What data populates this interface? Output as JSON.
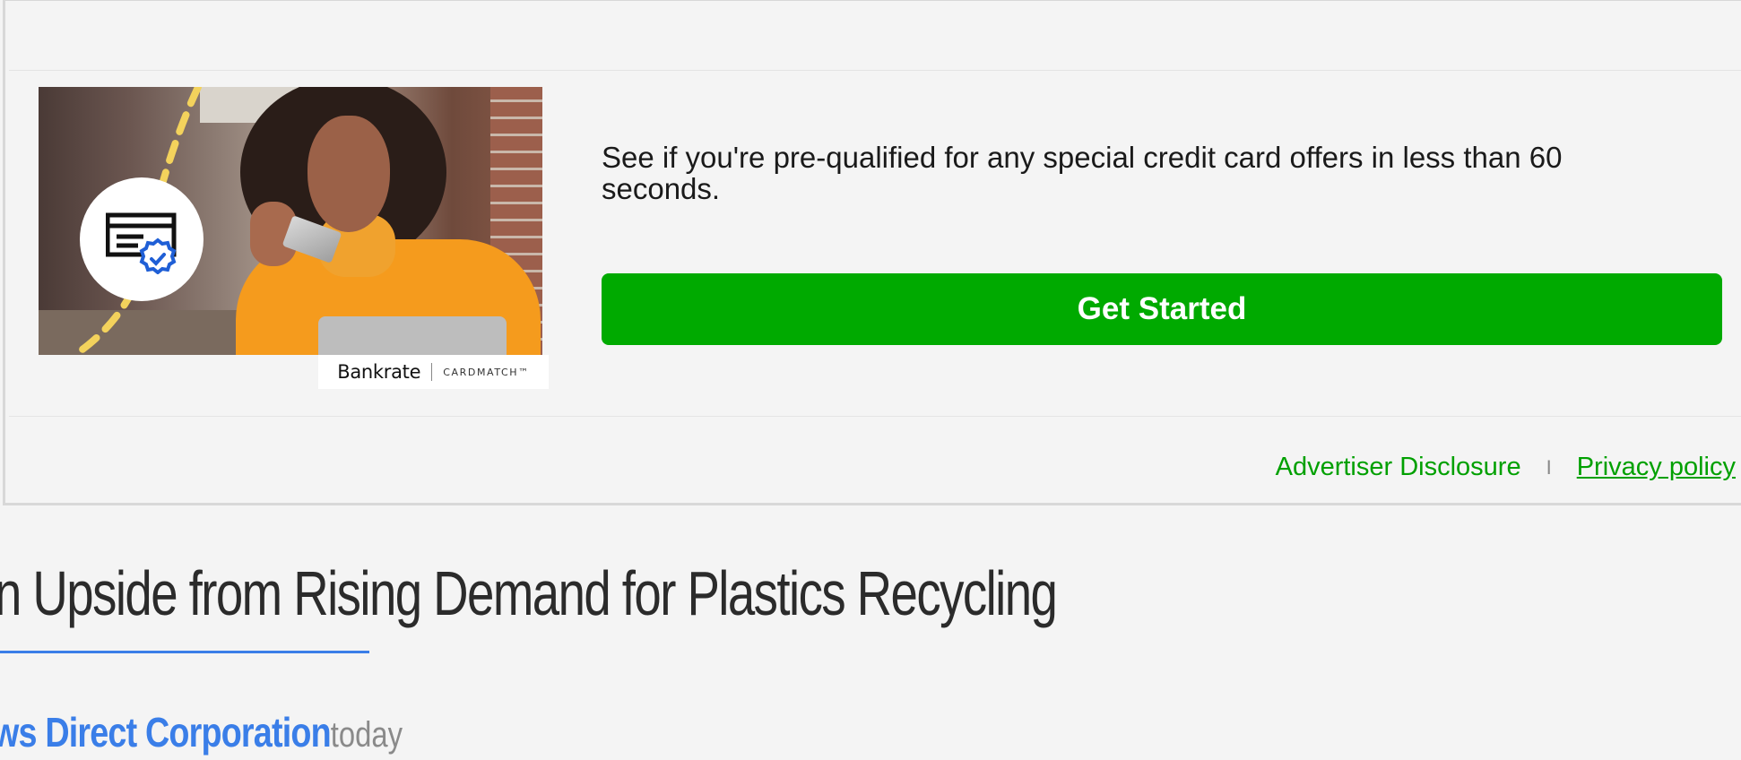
{
  "ad": {
    "text": "See if you're pre-qualified for any special credit card offers in less than 60 seconds.",
    "cta_label": "Get Started",
    "logo": {
      "brand": "Bankrate",
      "product": "CARDMATCH™"
    },
    "links": {
      "advertiser_disclosure": "Advertiser Disclosure",
      "separator": "I",
      "privacy_policy": "Privacy policy"
    },
    "colors": {
      "cta_background": "#00aa00",
      "link": "#00a000"
    },
    "image_badge_icon": "verified-card-icon"
  },
  "article": {
    "headline": "n Upside from Rising Demand for Plastics Recycling",
    "author": "ws Direct Corporation",
    "time": "today",
    "colors": {
      "accent": "#3a7ee8"
    }
  }
}
